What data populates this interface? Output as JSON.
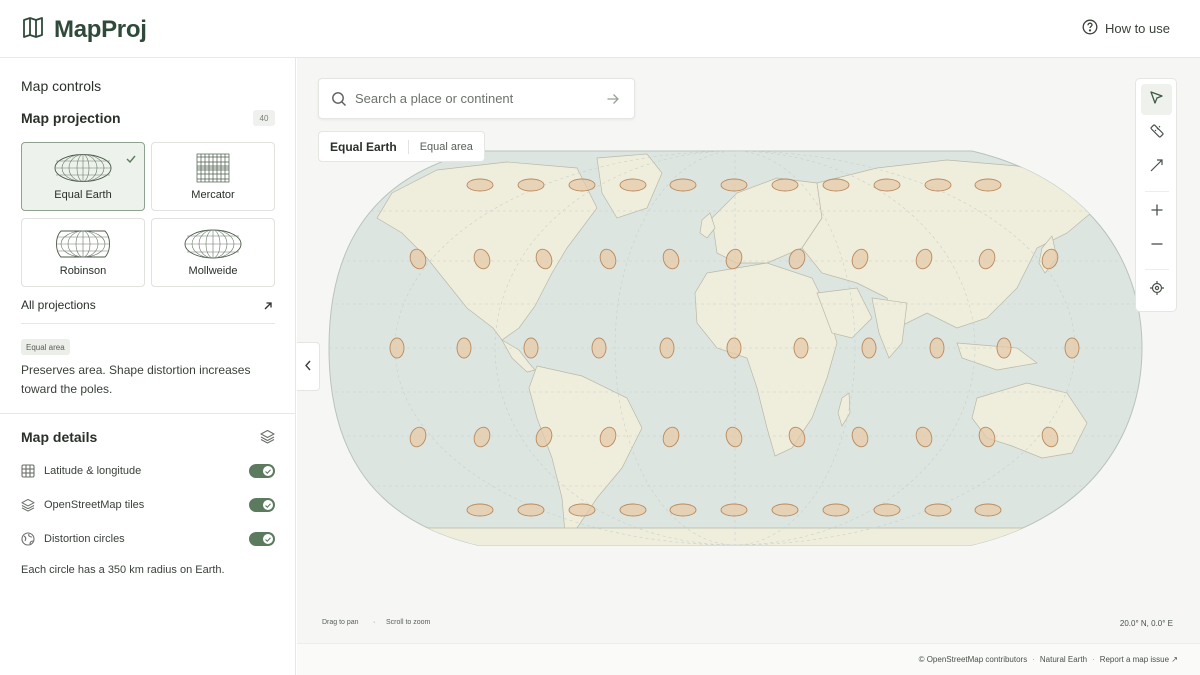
{
  "app": {
    "name": "MapProj"
  },
  "header": {
    "help_label": "How to use"
  },
  "sidebar": {
    "section_title": "Map controls",
    "projection": {
      "title": "Map projection",
      "count": "40",
      "options": [
        {
          "label": "Equal Earth",
          "selected": true
        },
        {
          "label": "Mercator",
          "selected": false
        },
        {
          "label": "Robinson",
          "selected": false
        },
        {
          "label": "Mollweide",
          "selected": false
        }
      ],
      "all_label": "All projections",
      "badge": "Equal area",
      "description": "Preserves area. Shape distortion increases toward the poles."
    },
    "details": {
      "title": "Map details",
      "toggles": [
        {
          "label": "Latitude & longitude",
          "icon": "grid-icon",
          "on": true
        },
        {
          "label": "OpenStreetMap tiles",
          "icon": "layers-icon",
          "on": true
        },
        {
          "label": "Distortion circles",
          "icon": "globe-icon",
          "on": true
        }
      ],
      "footnote": "Each circle has a 350 km radius on Earth."
    }
  },
  "map": {
    "search_placeholder": "Search a place or continent",
    "current_projection": "Equal Earth",
    "current_projection_kind": "Equal area",
    "hint_pan": "Drag to pan",
    "hint_zoom": "Scroll to zoom",
    "coordinates": "20.0° N, 0.0° E",
    "tools": [
      "pointer-icon",
      "ruler-icon",
      "measure-line-icon",
      "zoom-in-icon",
      "zoom-out-icon",
      "locate-icon"
    ]
  },
  "attribution": {
    "osm": "© OpenStreetMap contributors",
    "natural_earth": "Natural Earth",
    "report": "Report a map issue ↗"
  },
  "colors": {
    "accent": "#5b7a5e",
    "brand": "#2f4a3a",
    "ocean": "#dfe6e2",
    "land": "#efeedd",
    "circle_fill": "#e6c9a8",
    "circle_stroke": "#b98a5e"
  }
}
